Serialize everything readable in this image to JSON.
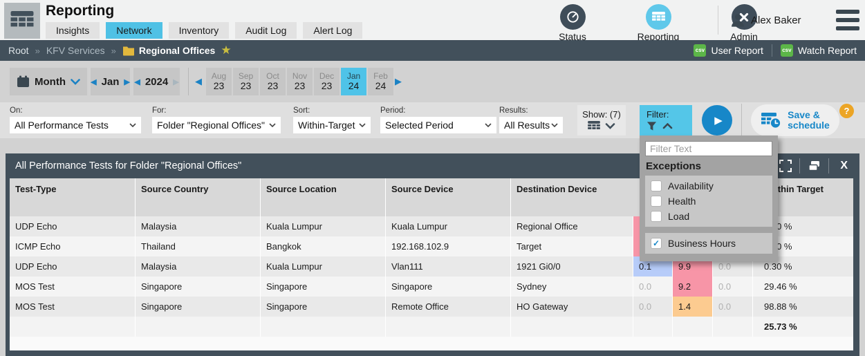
{
  "header": {
    "title": "Reporting",
    "tabs": [
      {
        "label": "Insights"
      },
      {
        "label": "Network",
        "state": "active"
      },
      {
        "label": "Inventory"
      },
      {
        "label": "Audit Log"
      },
      {
        "label": "Alert Log"
      }
    ],
    "nav": [
      {
        "label": "Status",
        "icon": "gauge-icon"
      },
      {
        "label": "Reporting",
        "icon": "table-icon",
        "state": "active"
      },
      {
        "label": "Admin",
        "icon": "tools-icon"
      }
    ],
    "user": "Alex Baker"
  },
  "breadcrumb": {
    "root": "Root",
    "separator": "»",
    "service": "KFV Services",
    "folder": "Regional Offices",
    "csv_badge": "csv",
    "user_report": "User Report",
    "watch_report": "Watch Report"
  },
  "datebar": {
    "mode": "Month",
    "month": "Jan",
    "year": "2024",
    "prev": "◀",
    "next": "▶",
    "periods": [
      {
        "m": "Aug",
        "y": "23"
      },
      {
        "m": "Sep",
        "y": "23"
      },
      {
        "m": "Oct",
        "y": "23"
      },
      {
        "m": "Nov",
        "y": "23"
      },
      {
        "m": "Dec",
        "y": "23"
      },
      {
        "m": "Jan",
        "y": "24",
        "state": "selected"
      },
      {
        "m": "Feb",
        "y": "24"
      }
    ]
  },
  "toolbar": {
    "fields": [
      {
        "label": "On:",
        "value": "All Performance Tests"
      },
      {
        "label": "For:",
        "value": "Folder \"Regional Offices\""
      },
      {
        "label": "Sort:",
        "value": "Within-Target"
      },
      {
        "label": "Period:",
        "value": "Selected Period"
      },
      {
        "label": "Results:",
        "value": "All Results"
      }
    ],
    "show_label": "Show: (7)",
    "filter_label": "Filter:",
    "run_icon": "play",
    "save_line1": "Save &",
    "save_line2": "schedule",
    "help_badge": "?"
  },
  "filter_panel": {
    "placeholder": "Filter Text",
    "section_title": "Exceptions",
    "exceptions": [
      {
        "label": "Availability",
        "checked": false,
        "check": "✓"
      },
      {
        "label": "Health",
        "checked": false,
        "check": "✓"
      },
      {
        "label": "Load",
        "checked": false,
        "check": "✓"
      }
    ],
    "extra": [
      {
        "label": "Business Hours",
        "checked": true,
        "check": "✓"
      }
    ]
  },
  "table": {
    "title": "All Performance Tests for Folder \"Regional Offices\"",
    "close_label": "X",
    "columns": [
      "Test-Type",
      "Source Country",
      "Source Location",
      "Source Device",
      "Destination Device"
    ],
    "within_target_col": "Within Target",
    "rows": [
      {
        "c1": "UDP Echo",
        "c2": "Malaysia",
        "c3": "Kuala Lumpur",
        "c4": "Kuala Lumpur",
        "c5": "Regional Office",
        "m1": "",
        "h1": "pink",
        "m2": "",
        "h2": "",
        "m3": "",
        "h3": "",
        "wt": "0.00 %"
      },
      {
        "c1": "ICMP Echo",
        "c2": "Thailand",
        "c3": "Bangkok",
        "c4": "192.168.102.9",
        "c5": "Target",
        "m1": "",
        "h1": "pink",
        "m2": "",
        "h2": "",
        "m3": "",
        "h3": "",
        "wt": "0.00 %"
      },
      {
        "c1": "UDP Echo",
        "c2": "Malaysia",
        "c3": "Kuala Lumpur",
        "c4": "Vlan111",
        "c5": "1921 Gi0/0",
        "m1": "0.1",
        "h1": "lavender",
        "m2": "9.9",
        "h2": "pink",
        "m3": "0.0",
        "h3": "muted",
        "wt": "0.30 %"
      },
      {
        "c1": "MOS Test",
        "c2": "Singapore",
        "c3": "Singapore",
        "c4": "Singapore",
        "c5": "Sydney",
        "m1": "0.0",
        "h1": "muted",
        "m2": "9.2",
        "h2": "pink",
        "m3": "0.0",
        "h3": "muted",
        "wt": "29.46 %"
      },
      {
        "c1": "MOS Test",
        "c2": "Singapore",
        "c3": "Singapore",
        "c4": "Remote Office",
        "c5": "HO Gateway",
        "m1": "0.0",
        "h1": "muted",
        "m2": "1.4",
        "h2": "orange",
        "m3": "0.0",
        "h3": "muted",
        "wt": "98.88 %"
      }
    ],
    "summary_within_target": "25.73 %"
  },
  "colors": {
    "accent_cyan": "#4fc1e5",
    "accent_blue": "#1787c8",
    "slate": "#42505b",
    "cell_pink": "#f795a7",
    "cell_lavender": "#b7ccf9",
    "cell_orange": "#fccb90",
    "csv_green": "#5cb648",
    "badge_amber": "#eca526",
    "favorite_yellow": "#c9bd3f",
    "folder_yellow": "#e2b83d"
  }
}
